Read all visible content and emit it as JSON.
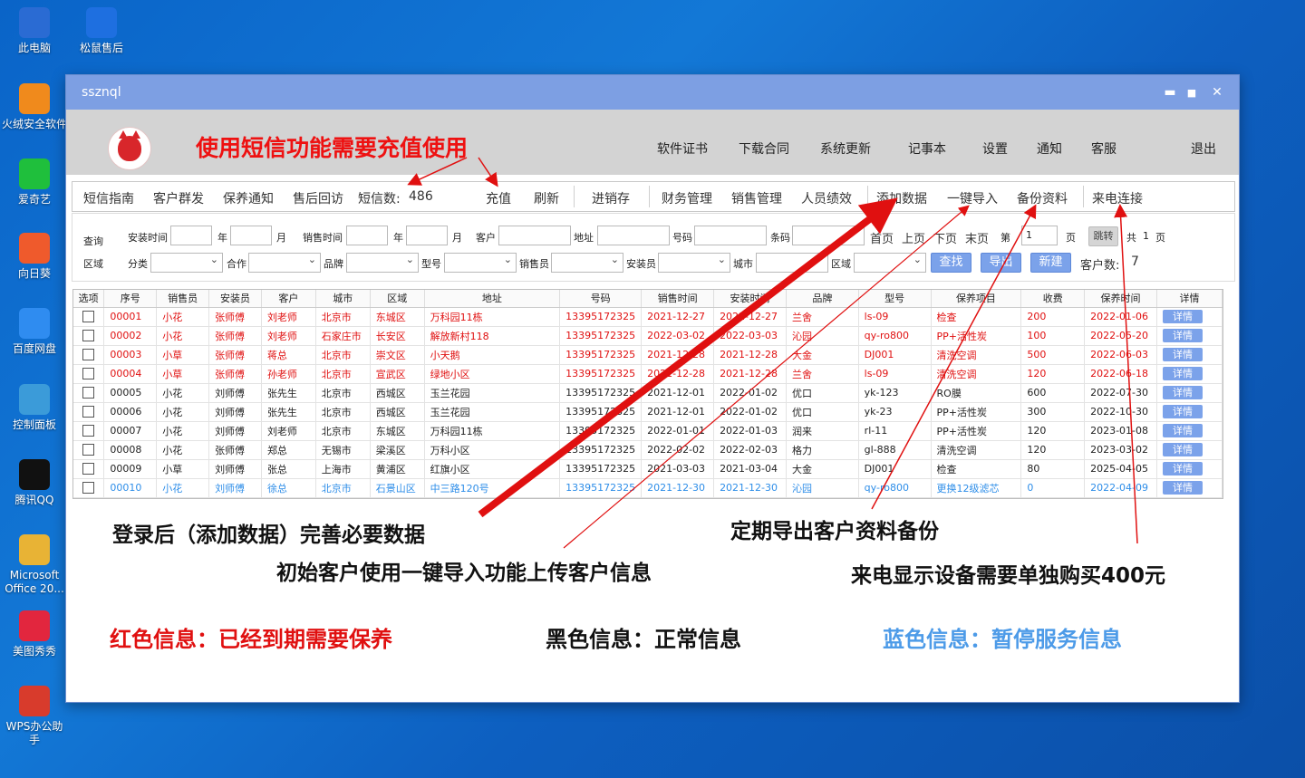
{
  "desktop": {
    "icons": [
      {
        "label": "此电脑",
        "icon": "computer-icon",
        "color": "#2a6bd3"
      },
      {
        "label": "松鼠售后",
        "icon": "app-s-icon",
        "color": "#1e6fe0"
      },
      {
        "label": "火绒安全软件",
        "icon": "huorong-icon",
        "color": "#f08a1c"
      },
      {
        "label": "爱奇艺",
        "icon": "iqiyi-icon",
        "color": "#1fbf3c"
      },
      {
        "label": "向日葵",
        "icon": "sunflower-icon",
        "color": "#ef5a2c"
      },
      {
        "label": "百度网盘",
        "icon": "baidu-netdisk-icon",
        "color": "#2f8cf0"
      },
      {
        "label": "控制面板",
        "icon": "control-panel-icon",
        "color": "#3b9bd9"
      },
      {
        "label": "腾讯QQ",
        "icon": "qq-icon",
        "color": "#111111"
      },
      {
        "label": "Microsoft Office 20...",
        "icon": "office-icon",
        "color": "#e8b335"
      },
      {
        "label": "美图秀秀",
        "icon": "meitu-icon",
        "color": "#e2263e"
      },
      {
        "label": "WPS办公助手",
        "icon": "wps-icon",
        "color": "#d83b2c"
      }
    ]
  },
  "window": {
    "title": "ssznql",
    "controls": {
      "minimize": "▬",
      "maximize": "■",
      "close": "✕"
    }
  },
  "header": {
    "note": "使用短信功能需要充值使用",
    "menu": [
      "软件证书",
      "下载合同",
      "系统更新",
      "记事本",
      "设置",
      "通知",
      "客服",
      "退出"
    ]
  },
  "toolbar": {
    "items": [
      "短信指南",
      "客户群发",
      "保养通知",
      "售后回访"
    ],
    "sms_label": "短信数:",
    "sms_count": "486",
    "recharge": "充值",
    "refresh": "刷新",
    "inventory": "进销存",
    "finance": "财务管理",
    "sales": "销售管理",
    "performance": "人员绩效",
    "add_data": "添加数据",
    "import": "一键导入",
    "backup": "备份资料",
    "caller": "来电连接"
  },
  "filter": {
    "row_label_1": "查询",
    "row_label_2": "区域",
    "install_time": "安装时间",
    "year": "年",
    "month": "月",
    "sale_time": "销售时间",
    "customer": "客户",
    "address": "地址",
    "phone": "号码",
    "barcode": "条码",
    "category": "分类",
    "cooperation": "合作",
    "brand": "品牌",
    "model": "型号",
    "seller": "销售员",
    "installer": "安装员",
    "city": "城市",
    "district": "区域",
    "search_btn": "查找",
    "export_btn": "导出",
    "new_btn": "新建",
    "customer_count_label": "客户数:",
    "customer_count": "7",
    "pager": {
      "first": "首页",
      "prev": "上页",
      "next": "下页",
      "last": "末页",
      "page_prefix": "第",
      "page_value": "1",
      "page_suffix": "页",
      "jump": "跳转",
      "total_prefix": "共",
      "total": "1",
      "total_suffix": "页"
    }
  },
  "grid": {
    "columns": [
      "选项",
      "序号",
      "销售员",
      "安装员",
      "客户",
      "城市",
      "区域",
      "地址",
      "号码",
      "销售时间",
      "安装时间",
      "品牌",
      "型号",
      "保养项目",
      "收费",
      "保养时间",
      "详情"
    ],
    "detail_label": "详情",
    "rows": [
      {
        "status": "red",
        "cells": [
          "00001",
          "小花",
          "张师傅",
          "刘老师",
          "北京市",
          "东城区",
          "万科园11栋",
          "13395172325",
          "2021-12-27",
          "2021-12-27",
          "兰舍",
          "ls-09",
          "检查",
          "200",
          "2022-01-06"
        ]
      },
      {
        "status": "red",
        "cells": [
          "00002",
          "小花",
          "张师傅",
          "刘老师",
          "石家庄市",
          "长安区",
          "解放新村118",
          "13395172325",
          "2022-03-02",
          "2022-03-03",
          "沁园",
          "qy-ro800",
          "PP+活性炭",
          "100",
          "2022-05-20"
        ]
      },
      {
        "status": "red",
        "cells": [
          "00003",
          "小草",
          "张师傅",
          "蒋总",
          "北京市",
          "崇文区",
          "小天鹅",
          "13395172325",
          "2021-12-28",
          "2021-12-28",
          "大金",
          "DJ001",
          "清洗空调",
          "500",
          "2022-06-03"
        ]
      },
      {
        "status": "red",
        "cells": [
          "00004",
          "小草",
          "张师傅",
          "孙老师",
          "北京市",
          "宣武区",
          "绿地小区",
          "13395172325",
          "2021-12-28",
          "2021-12-28",
          "兰舍",
          "ls-09",
          "清洗空调",
          "120",
          "2022-06-18"
        ]
      },
      {
        "status": "black",
        "cells": [
          "00005",
          "小花",
          "刘师傅",
          "张先生",
          "北京市",
          "西城区",
          "玉兰花园",
          "13395172325",
          "2021-12-01",
          "2022-01-02",
          "优口",
          "yk-123",
          "RO膜",
          "600",
          "2022-07-30"
        ]
      },
      {
        "status": "black",
        "cells": [
          "00006",
          "小花",
          "刘师傅",
          "张先生",
          "北京市",
          "西城区",
          "玉兰花园",
          "13395172325",
          "2021-12-01",
          "2022-01-02",
          "优口",
          "yk-23",
          "PP+活性炭",
          "300",
          "2022-10-30"
        ]
      },
      {
        "status": "black",
        "cells": [
          "00007",
          "小花",
          "刘师傅",
          "刘老师",
          "北京市",
          "东城区",
          "万科园11栋",
          "13395172325",
          "2022-01-01",
          "2022-01-03",
          "润来",
          "rl-11",
          "PP+活性炭",
          "120",
          "2023-01-08"
        ]
      },
      {
        "status": "black",
        "cells": [
          "00008",
          "小花",
          "张师傅",
          "郑总",
          "无锡市",
          "梁溪区",
          "万科小区",
          "13395172325",
          "2022-02-02",
          "2022-02-03",
          "格力",
          "gl-888",
          "清洗空调",
          "120",
          "2023-03-02"
        ]
      },
      {
        "status": "black",
        "cells": [
          "00009",
          "小草",
          "刘师傅",
          "张总",
          "上海市",
          "黄浦区",
          "红旗小区",
          "13395172325",
          "2021-03-03",
          "2021-03-04",
          "大金",
          "DJ001",
          "检查",
          "80",
          "2025-04-05"
        ]
      },
      {
        "status": "blue",
        "cells": [
          "00010",
          "小花",
          "刘师傅",
          "徐总",
          "北京市",
          "石景山区",
          "中三路120号",
          "13395172325",
          "2021-12-30",
          "2021-12-30",
          "沁园",
          "qy-ro800",
          "更换12级滤芯",
          "0",
          "2022-04-09"
        ]
      }
    ]
  },
  "annotations": {
    "add_data": "登录后（添加数据）完善必要数据",
    "backup": "定期导出客户资料备份",
    "import": "初始客户使用一键导入功能上传客户信息",
    "caller": "来电显示设备需要单独购买400元",
    "legend_red": "红色信息：已经到期需要保养",
    "legend_black": "黑色信息：正常信息",
    "legend_blue": "蓝色信息：暂停服务信息"
  },
  "colors": {
    "desktop_bg": "#0b64c6",
    "titlebar": "#7d9fe3",
    "accent_button": "#7ba2ea",
    "expired_red": "#e01010",
    "normal_black": "#222222",
    "suspended_blue": "#2d8de8"
  }
}
